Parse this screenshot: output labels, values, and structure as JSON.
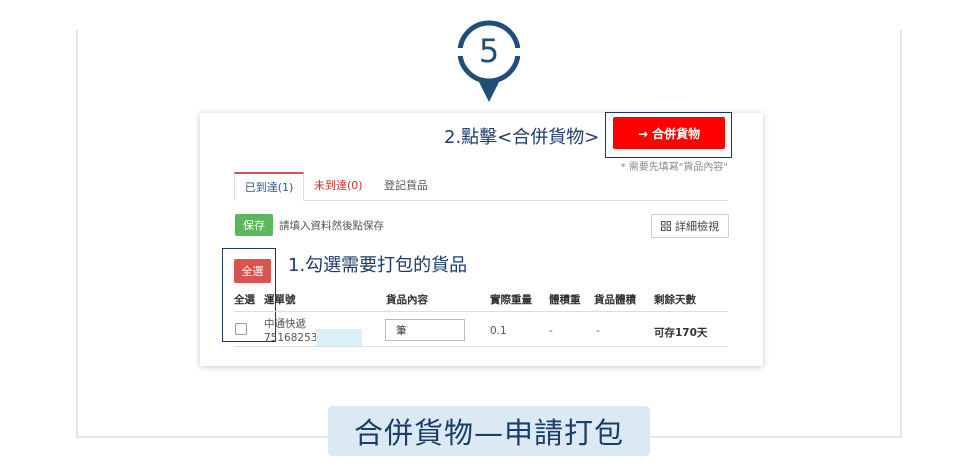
{
  "step": {
    "number": "5"
  },
  "annotations": {
    "merge": "2.點擊<合併貨物>",
    "select": "1.勾選需要打包的貨品"
  },
  "merge_button": {
    "label": "→ 合併貨物",
    "note": "* 需要先填寫\"貨品內容\""
  },
  "tabs": [
    {
      "label": "已到達(1)"
    },
    {
      "label": "未到達(0)"
    },
    {
      "label": "登記貨品"
    }
  ],
  "toolbar": {
    "save_label": "保存",
    "save_hint": "請填入資料然後點保存",
    "detail_label": "詳細檢視"
  },
  "select_all_label": "全選",
  "table": {
    "headers": [
      "全選",
      "運單號",
      "貨品內容",
      "實際重量",
      "體積重",
      "貨品體積",
      "剩餘天數"
    ],
    "rows": [
      {
        "carrier": "中通快遞",
        "tracking": "75168253",
        "content": "筆",
        "actual_weight": "0.1",
        "volume_weight": "-",
        "volume": "-",
        "days_left": "可存170天"
      }
    ]
  },
  "caption": "合併貨物—申請打包",
  "colors": {
    "primary": "#1a3d6b",
    "danger": "#ff0000",
    "success": "#5cb85c",
    "panel": "#dbe9f2"
  }
}
